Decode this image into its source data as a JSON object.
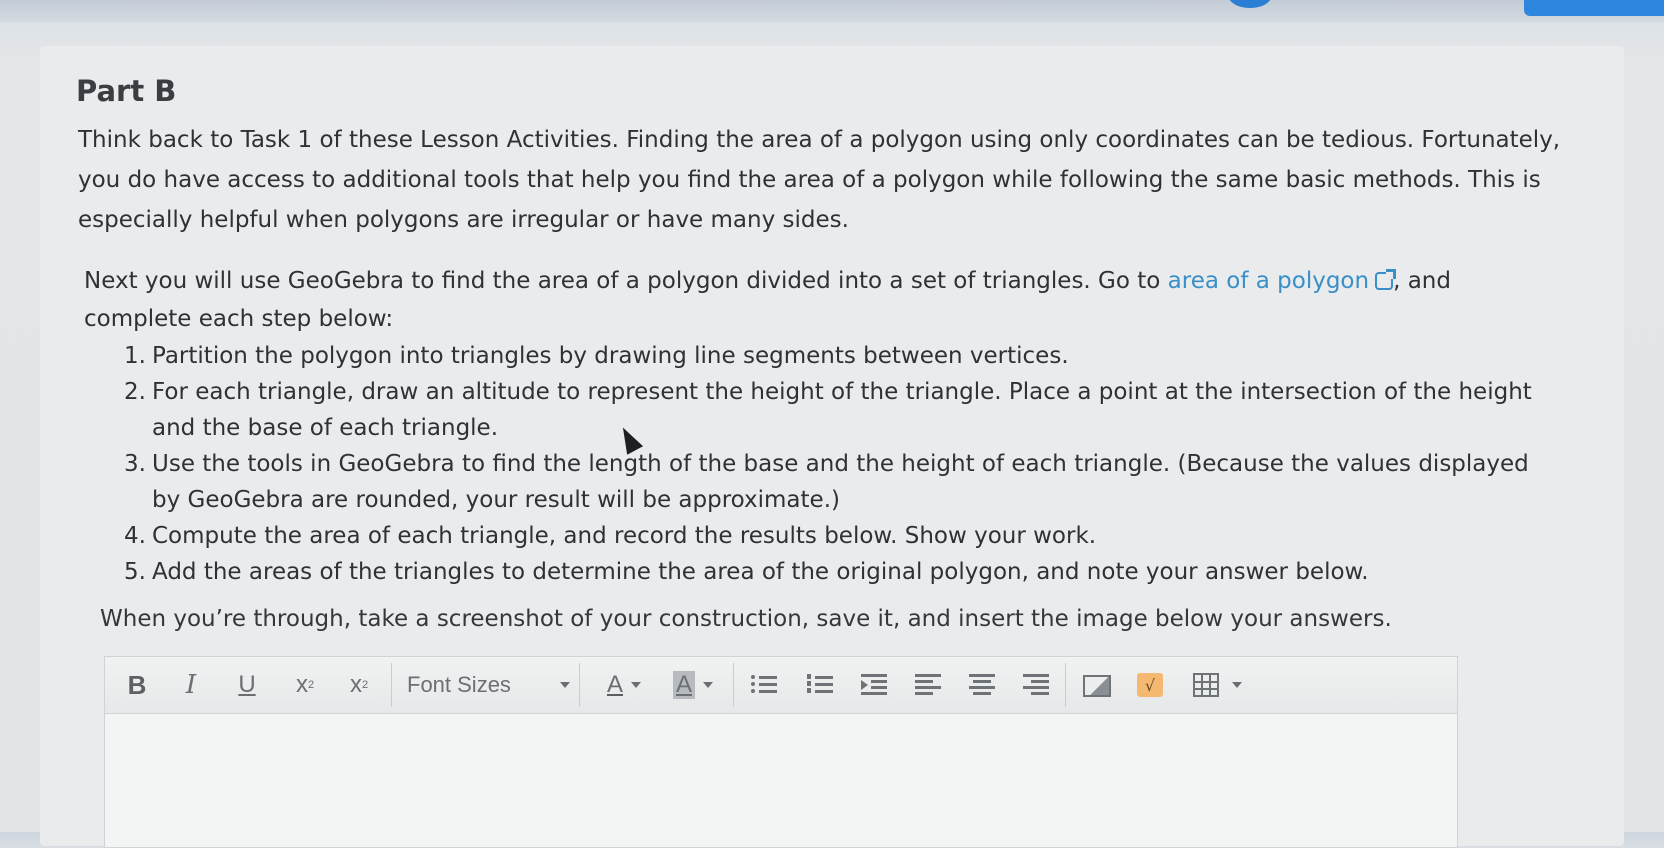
{
  "part": {
    "title": "Part B"
  },
  "intro": {
    "text": "Think back to Task 1 of these Lesson Activities. Finding the area of a polygon using only coordinates can be tedious. Fortunately, you do have access to additional tools that help you find the area of a polygon while following the same basic methods. This is especially helpful when polygons are irregular or have many sides."
  },
  "instructions": {
    "before_link": "Next you will use GeoGebra to find the area of a polygon divided into a set of triangles. Go to",
    "link_text": "area of a polygon",
    "link_icon": "external-link-icon",
    "after_link": ", and complete each step below:"
  },
  "steps": [
    {
      "num": "1.",
      "text": "Partition the polygon into triangles by drawing line segments between vertices."
    },
    {
      "num": "2.",
      "text": "For each triangle, draw an altitude to represent the height of the triangle. Place a point at the intersection of the height and the base of each triangle."
    },
    {
      "num": "3.",
      "text": "Use the tools in GeoGebra to find the length of the base and the height of each triangle. (Because the values displayed by GeoGebra are rounded, your result will be approximate.)"
    },
    {
      "num": "4.",
      "text": "Compute the area of each triangle, and record the results below. Show your work."
    },
    {
      "num": "5.",
      "text": "Add the areas of the triangles to determine the area of the original polygon, and note your answer below."
    }
  ],
  "closing": {
    "text": "When you’re through, take a screenshot of your construction, save it, and insert the image below your answers."
  },
  "toolbar": {
    "bold": "B",
    "italic": "I",
    "underline": "U",
    "superscript": "x",
    "superscript_mark": "2",
    "subscript": "x",
    "subscript_mark": "2",
    "font_sizes": "Font Sizes",
    "font_color": "A",
    "highlight_color": "A",
    "sqrt_symbol": "√",
    "icons": [
      "bullet-list-icon",
      "numbered-list-icon",
      "indent-icon",
      "align-left-icon",
      "align-center-icon",
      "align-right-icon",
      "insert-image-icon",
      "math-equation-icon",
      "insert-table-icon"
    ]
  },
  "colors": {
    "link": "#3a8fc8",
    "page": "#e4e7e9",
    "accent": "#2f86de",
    "math_button": "#f5b870"
  }
}
